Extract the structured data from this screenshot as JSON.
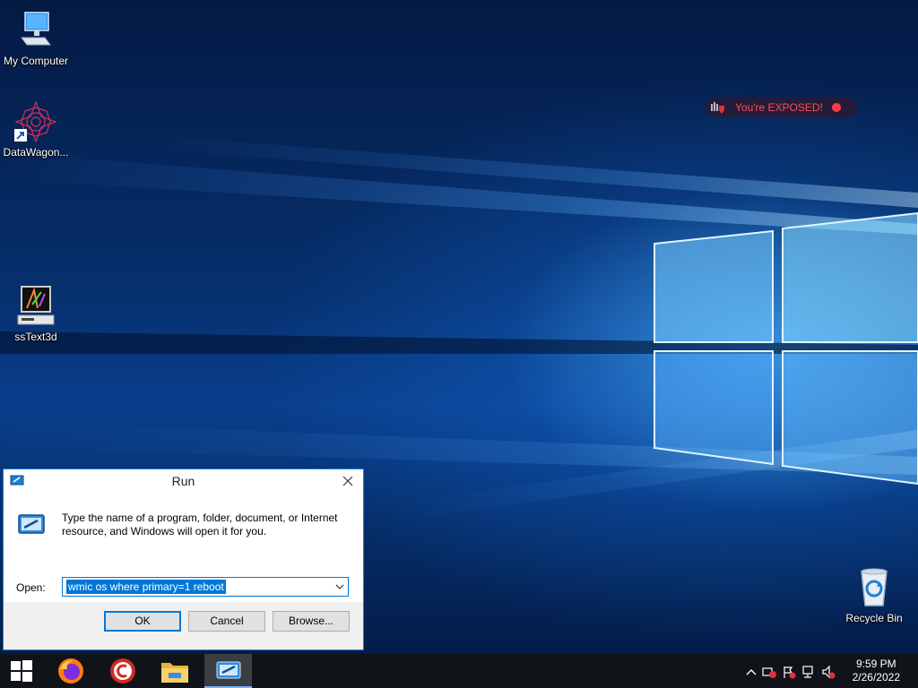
{
  "desktop": {
    "icons": [
      {
        "label": "My Computer"
      },
      {
        "label": "DataWagon..."
      },
      {
        "label": "ssText3d"
      },
      {
        "label": "Recycle Bin"
      }
    ],
    "exposed_badge": {
      "text": "You're EXPOSED!",
      "color": "#ff3b48"
    }
  },
  "run_dialog": {
    "title": "Run",
    "description": "Type the name of a program, folder, document, or Internet resource, and Windows will open it for you.",
    "open_label": "Open:",
    "command_value": "wmic os where primary=1 reboot",
    "buttons": {
      "ok": "OK",
      "cancel": "Cancel",
      "browse": "Browse..."
    }
  },
  "taskbar": {
    "apps": [
      "start-icon",
      "firefox-icon",
      "ccleaner-icon",
      "file-explorer-icon",
      "run-icon"
    ],
    "clock": {
      "time": "9:59 PM",
      "date": "2/26/2022"
    }
  },
  "colors": {
    "accent": "#0078d7",
    "taskbar": "#101318"
  }
}
